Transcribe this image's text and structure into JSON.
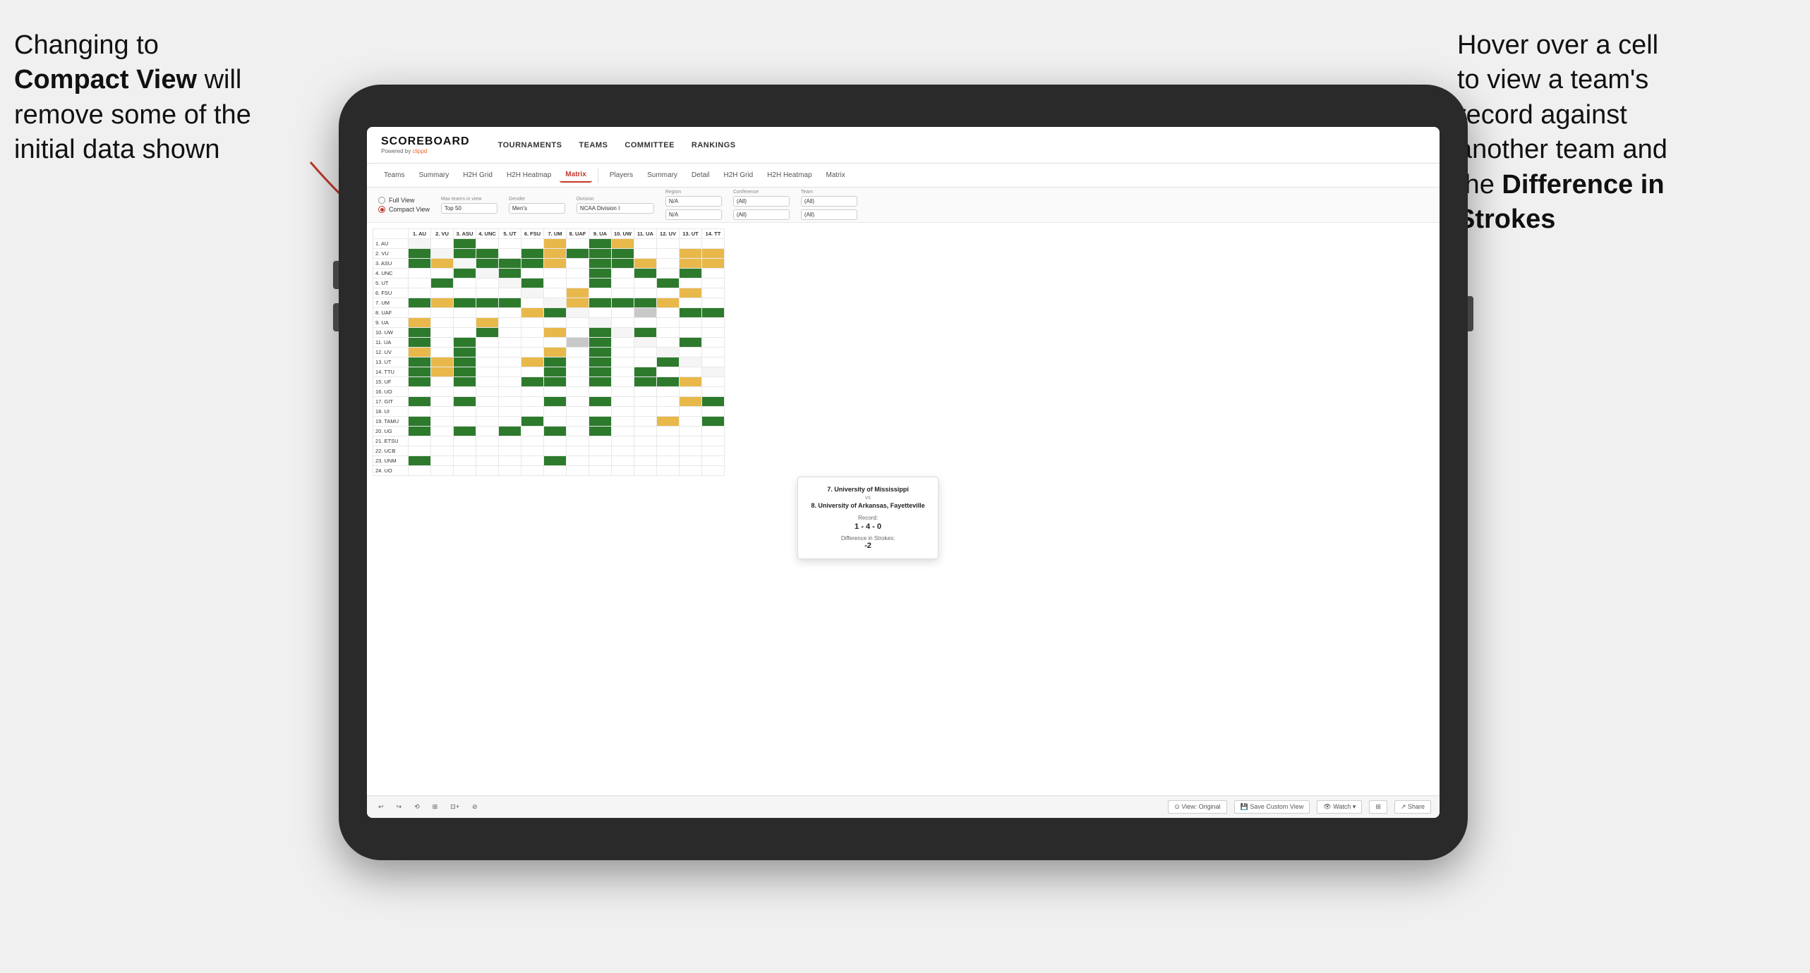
{
  "annotations": {
    "left": {
      "line1": "Changing to",
      "line2": "Compact View will",
      "line3": "remove some of the",
      "line4": "initial data shown"
    },
    "right": {
      "line1": "Hover over a cell",
      "line2": "to view a team's",
      "line3": "record against",
      "line4": "another team and",
      "line5": "the ",
      "bold": "Difference in Strokes"
    }
  },
  "header": {
    "logo": "SCOREBOARD",
    "powered_by": "Powered by clippd",
    "nav": [
      "TOURNAMENTS",
      "TEAMS",
      "COMMITTEE",
      "RANKINGS"
    ]
  },
  "sub_nav": {
    "group1": [
      "Teams",
      "Summary",
      "H2H Grid",
      "H2H Heatmap",
      "Matrix"
    ],
    "group2": [
      "Players",
      "Summary",
      "Detail",
      "H2H Grid",
      "H2H Heatmap",
      "Matrix"
    ],
    "active": "Matrix"
  },
  "controls": {
    "view_full": "Full View",
    "view_compact": "Compact View",
    "filters": [
      {
        "label": "Max teams in view",
        "value": "Top 50"
      },
      {
        "label": "Gender",
        "value": "Men's"
      },
      {
        "label": "Division",
        "value": "NCAA Division I"
      },
      {
        "label": "Region",
        "value": "N/A",
        "second_row": "N/A"
      },
      {
        "label": "Conference",
        "value": "(All)",
        "second_row": "(All)"
      },
      {
        "label": "Team",
        "value": "(All)",
        "second_row": "(All)"
      }
    ]
  },
  "matrix": {
    "col_headers": [
      "1. AU",
      "2. VU",
      "3. ASU",
      "4. UNC",
      "5. UT",
      "6. FSU",
      "7. UM",
      "8. UAF",
      "9. UA",
      "10. UW",
      "11. UA",
      "12. UV",
      "13. UT",
      "14. TT"
    ],
    "row_headers": [
      "1. AU",
      "2. VU",
      "3. ASU",
      "4. UNC",
      "5. UT",
      "6. FSU",
      "7. UM",
      "8. UAF",
      "9. UA",
      "10. UW",
      "11. UA",
      "12. UV",
      "13. UT",
      "14. TTU",
      "15. UF",
      "16. UO",
      "17. GIT",
      "18. UI",
      "19. TAMU",
      "20. UG",
      "21. ETSU",
      "22. UCB",
      "23. UNM",
      "24. UO"
    ]
  },
  "tooltip": {
    "team1": "7. University of Mississippi",
    "vs": "vs",
    "team2": "8. University of Arkansas, Fayetteville",
    "record_label": "Record:",
    "record": "1 - 4 - 0",
    "diff_label": "Difference in Strokes:",
    "diff": "-2"
  },
  "toolbar": {
    "buttons": [
      "↩",
      "↪",
      "⟲",
      "⊞",
      "⊡+",
      "⊘",
      "View: Original",
      "Save Custom View",
      "Watch ▾",
      "⊞",
      "Share"
    ]
  }
}
